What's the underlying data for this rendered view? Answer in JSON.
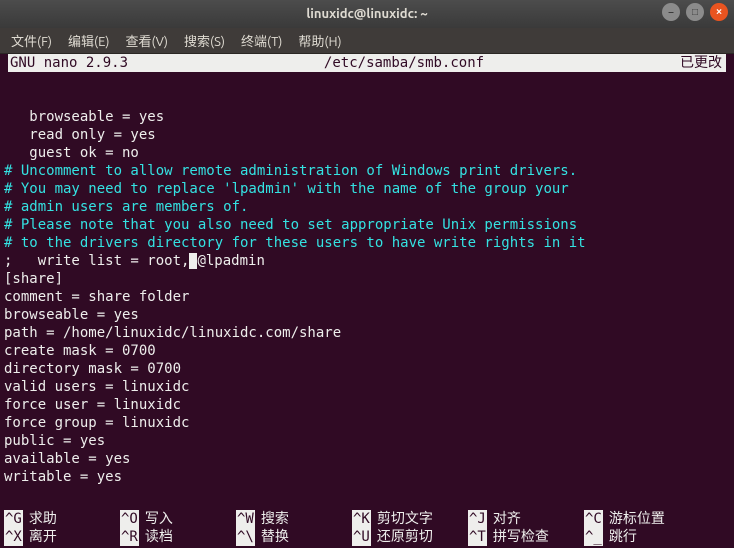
{
  "window": {
    "title": "linuxidc@linuxidc: ~"
  },
  "menubar": {
    "file": "文件(F)",
    "edit": "编辑(E)",
    "view": "查看(V)",
    "search": "搜索(S)",
    "terminal": "终端(T)",
    "help": "帮助(H)"
  },
  "nano": {
    "app": " GNU nano 2.9.3",
    "file": "/etc/samba/smb.conf",
    "status": "已更改 "
  },
  "lines": {
    "l0": "",
    "l1": "   browseable = yes",
    "l2": "   read only = yes",
    "l3": "   guest ok = no",
    "c1": "# Uncomment to allow remote administration of Windows print drivers.",
    "c2": "# You may need to replace 'lpadmin' with the name of the group your",
    "c3": "# admin users are members of.",
    "c4": "# Please note that you also need to set appropriate Unix permissions",
    "c5": "# to the drivers directory for these users to have write rights in it",
    "w1a": ";   write list = root,",
    "w1b": "@lpadmin",
    "s1": "[share]",
    "s2": "comment = share folder",
    "s3": "browseable = yes",
    "s4": "path = /home/linuxidc/linuxidc.com/share",
    "s5": "create mask = 0700",
    "s6": "directory mask = 0700",
    "s7": "valid users = linuxidc",
    "s8": "force user = linuxidc",
    "s9": "force group = linuxidc",
    "s10": "public = yes",
    "s11": "available = yes",
    "s12": "writable = yes"
  },
  "shortcuts": {
    "r1": [
      {
        "k": "^G",
        "t": "求助"
      },
      {
        "k": "^O",
        "t": "写入"
      },
      {
        "k": "^W",
        "t": "搜索"
      },
      {
        "k": "^K",
        "t": "剪切文字"
      },
      {
        "k": "^J",
        "t": "对齐"
      },
      {
        "k": "^C",
        "t": "游标位置"
      }
    ],
    "r2": [
      {
        "k": "^X",
        "t": "离开"
      },
      {
        "k": "^R",
        "t": "读档"
      },
      {
        "k": "^\\",
        "t": "替换"
      },
      {
        "k": "^U",
        "t": "还原剪切"
      },
      {
        "k": "^T",
        "t": "拼写检查"
      },
      {
        "k": "^_",
        "t": "跳行"
      }
    ]
  }
}
